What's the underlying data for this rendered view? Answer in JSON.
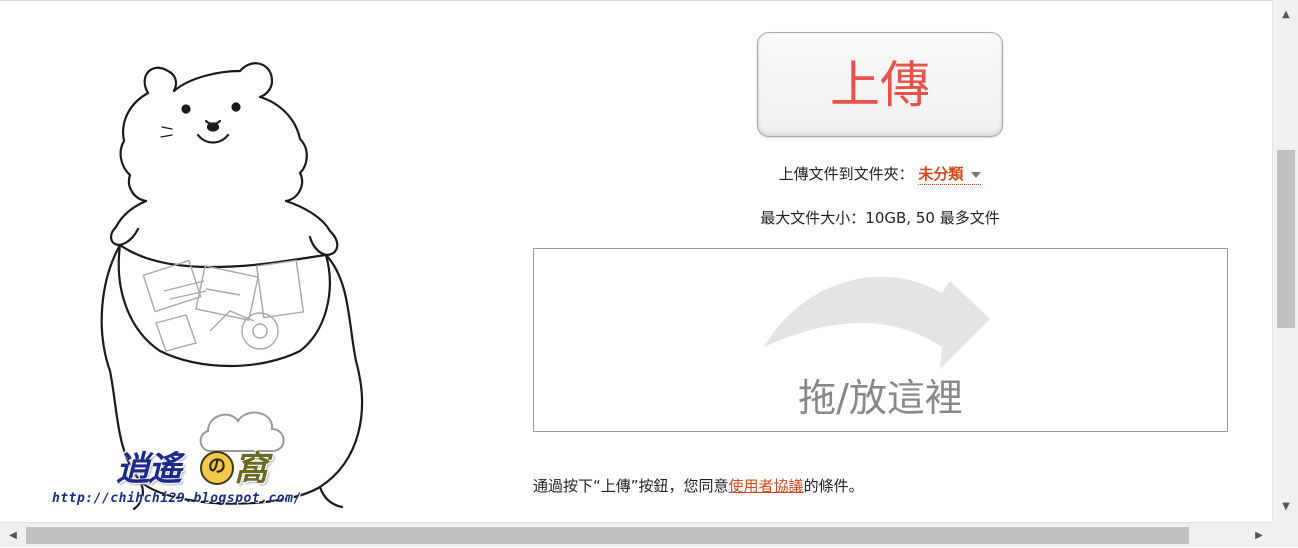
{
  "upload": {
    "button_label": "上傳",
    "folder_prefix": "上傳文件到文件夾：",
    "folder_value": "未分類",
    "max_size": "最大文件大小：10GB, 50 最多文件"
  },
  "drop_zone": {
    "label": "拖/放這裡"
  },
  "terms": {
    "before": "通過按下“上傳”按鈕，您同意",
    "link": "使用者協議",
    "after": "的條件。"
  },
  "watermark": {
    "logo_text": "逍遙",
    "logo_no": "の",
    "logo_suffix": "窩",
    "url": "http://chihchi29.blogspot.com/"
  },
  "scrollbar": {
    "up_icon": "triangle-up-icon",
    "down_icon": "triangle-down-icon",
    "left_icon": "triangle-left-icon",
    "right_icon": "triangle-right-icon"
  },
  "colors": {
    "accent_red": "#e8524a",
    "link_orange": "#d14a1e"
  }
}
